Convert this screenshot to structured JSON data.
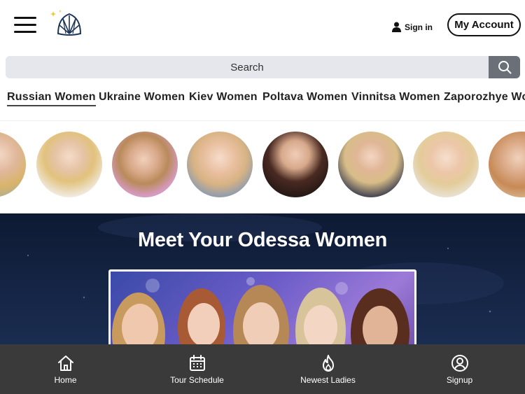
{
  "header": {
    "menu_icon": "hamburger-menu-icon",
    "logo_icon": "shell-logo-icon",
    "signin_label": "Sign in",
    "account_label": "My Account"
  },
  "search": {
    "placeholder": "Search",
    "icon": "search-icon"
  },
  "nav": {
    "items": [
      {
        "label": "Russian Women"
      },
      {
        "label": "Ukraine Women"
      },
      {
        "label": "Kiev Women"
      },
      {
        "label": "Poltava Women"
      },
      {
        "label": "Vinnitsa Women"
      },
      {
        "label": "Zaporozhye Wo"
      }
    ]
  },
  "avatars": {
    "count_visible": 8
  },
  "banner": {
    "title": "Meet Your Odessa Women"
  },
  "bottom_nav": {
    "tabs": [
      {
        "label": "Home",
        "icon": "home-icon"
      },
      {
        "label": "Tour Schedule",
        "icon": "calendar-icon"
      },
      {
        "label": "Newest Ladies",
        "icon": "flame-icon"
      },
      {
        "label": "Signup",
        "icon": "user-circle-icon"
      }
    ]
  },
  "colors": {
    "banner_bg": "#0e1a33",
    "bottom_bar": "#3a3a3a",
    "search_bg": "#e5e7ec",
    "search_button": "#6b7078"
  }
}
